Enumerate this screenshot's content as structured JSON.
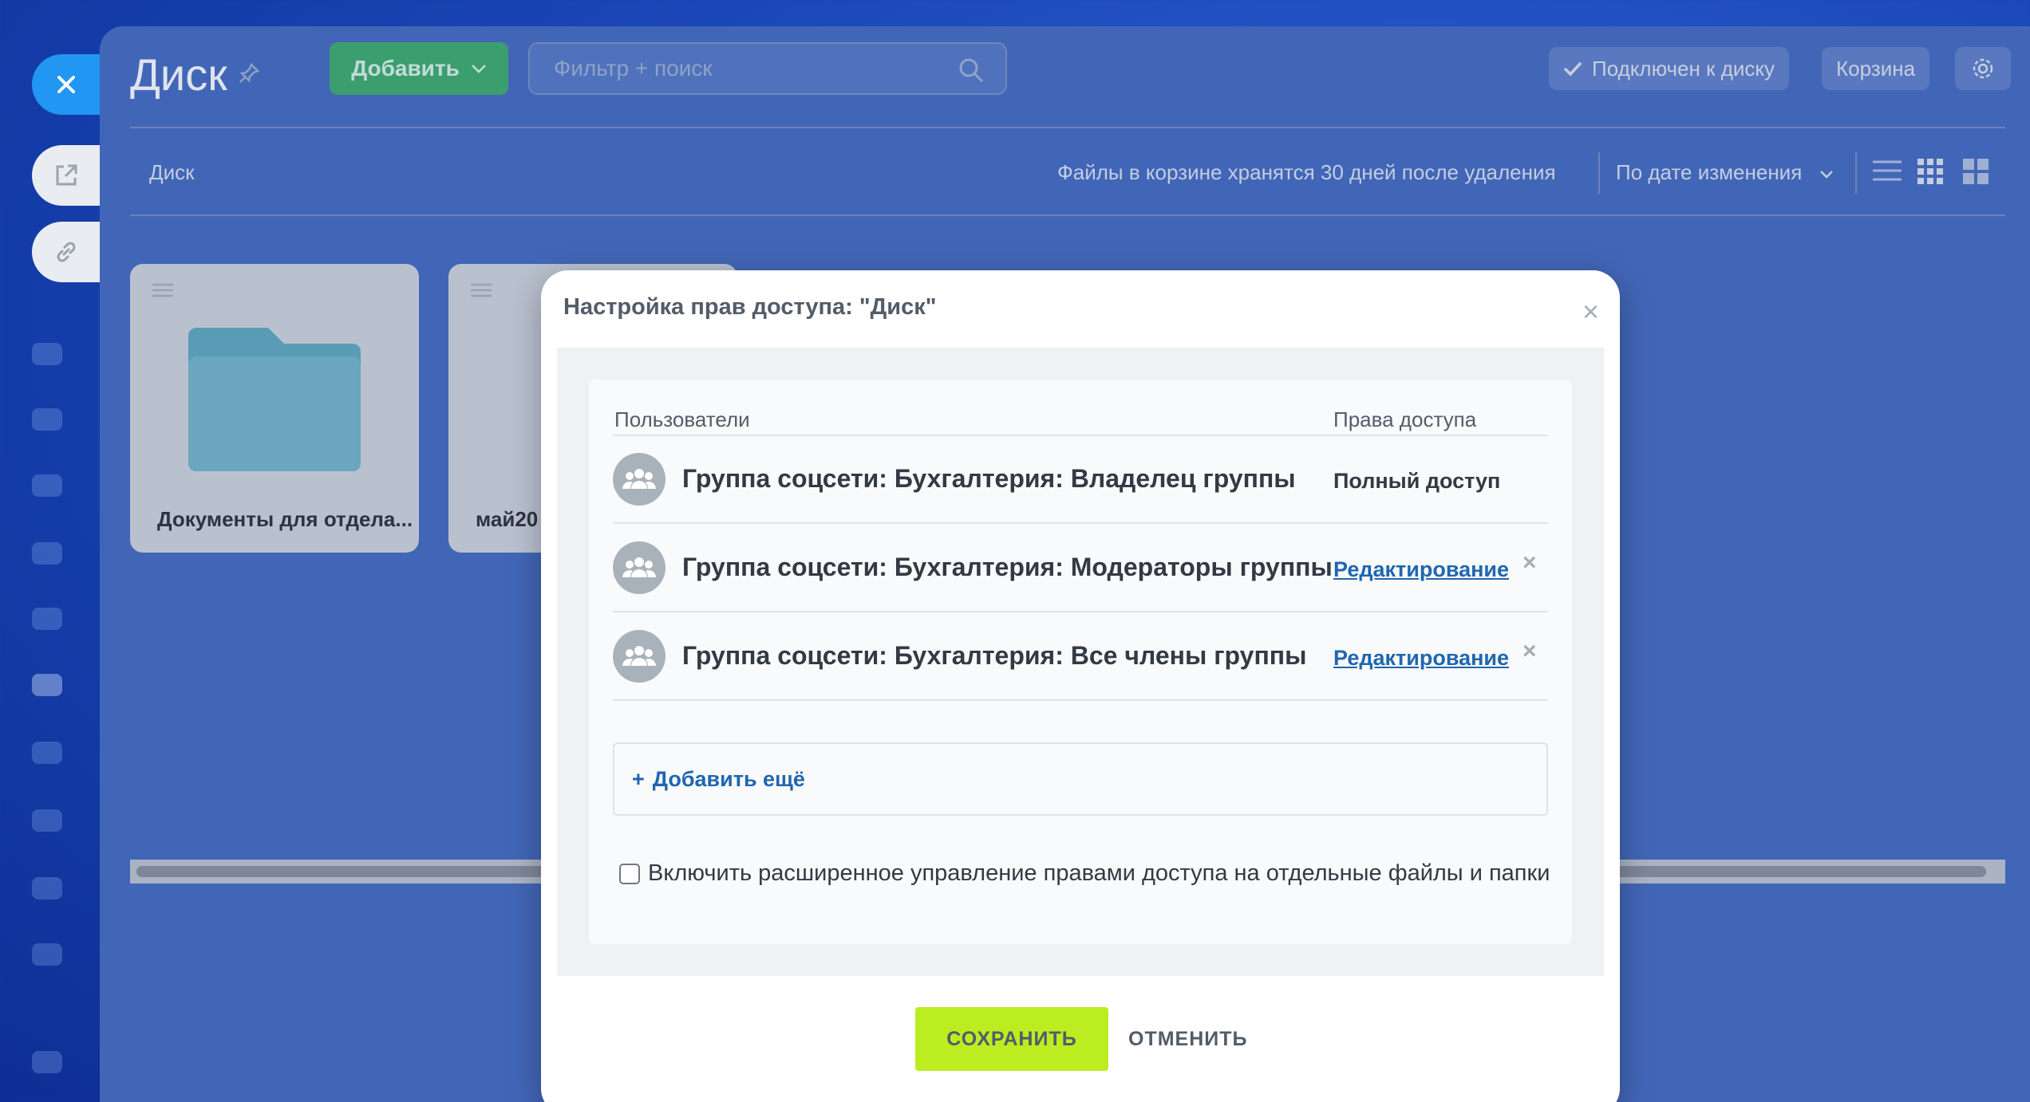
{
  "background": {
    "page_title": "Диск",
    "add_button_label": "Добавить",
    "search_placeholder": "Фильтр + поиск",
    "connected_label": "Подключен к диску",
    "trash_label": "Корзина",
    "breadcrumb": "Диск",
    "trash_note": "Файлы в корзине хранятся 30 дней после удаления",
    "sort_label": "По дате изменения",
    "tiles": [
      {
        "label": "Документы для отдела..."
      },
      {
        "label": "май20"
      }
    ]
  },
  "modal": {
    "title": "Настройка прав доступа: \"Диск\"",
    "close_glyph": "×",
    "col_users": "Пользователи",
    "col_rights": "Права доступа",
    "rows": [
      {
        "name": "Группа соцсети: Бухгалтерия: Владелец группы",
        "right": "Полный доступ",
        "editable": false
      },
      {
        "name": "Группа соцсети: Бухгалтерия: Модераторы группы",
        "right": "Редактирование",
        "editable": true
      },
      {
        "name": "Группа соцсети: Бухгалтерия: Все члены группы",
        "right": "Редактирование",
        "editable": true
      }
    ],
    "remove_glyph": "×",
    "add_more_plus": "+",
    "add_more_label": "Добавить ещё",
    "checkbox_label": "Включить расширенное управление правами доступа на отдельные файлы и папки",
    "checkbox_checked": false,
    "save_label": "СОХРАНИТЬ",
    "cancel_label": "ОТМЕНИТЬ"
  },
  "colors": {
    "save_button": "#bbed21",
    "link": "#2066b0",
    "close_tab": "#2196f3"
  }
}
